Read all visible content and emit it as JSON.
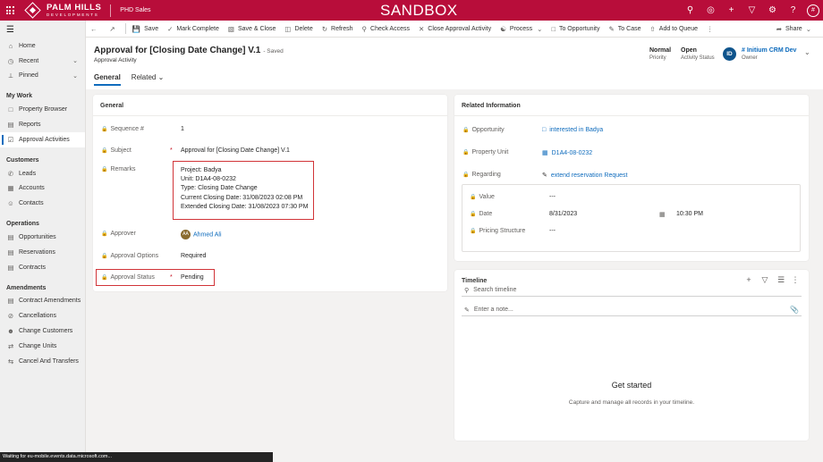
{
  "topbar": {
    "logo_main": "PALM HILLS",
    "logo_sub": "DEVELOPMENTS",
    "app_name": "PHD Sales",
    "environment": "SANDBOX",
    "user_initial": "#"
  },
  "sidebar": {
    "top_items": [
      {
        "label": "Home",
        "icon": "home-icon"
      },
      {
        "label": "Recent",
        "icon": "clock-icon"
      },
      {
        "label": "Pinned",
        "icon": "pin-icon"
      }
    ],
    "sections": [
      {
        "title": "My Work",
        "items": [
          {
            "label": "Property Browser"
          },
          {
            "label": "Reports"
          },
          {
            "label": "Approval Activities",
            "active": true
          }
        ]
      },
      {
        "title": "Customers",
        "items": [
          {
            "label": "Leads"
          },
          {
            "label": "Accounts"
          },
          {
            "label": "Contacts"
          }
        ]
      },
      {
        "title": "Operations",
        "items": [
          {
            "label": "Opportunities"
          },
          {
            "label": "Reservations"
          },
          {
            "label": "Contracts"
          }
        ]
      },
      {
        "title": "Amendments",
        "items": [
          {
            "label": "Contract Amendments"
          },
          {
            "label": "Cancellations"
          },
          {
            "label": "Change Customers"
          },
          {
            "label": "Change Units"
          },
          {
            "label": "Cancel And Transfers"
          }
        ]
      }
    ]
  },
  "commands": {
    "save": "Save",
    "mark_complete": "Mark Complete",
    "save_close": "Save & Close",
    "delete": "Delete",
    "refresh": "Refresh",
    "check_access": "Check Access",
    "close_approval": "Close Approval Activity",
    "process": "Process",
    "to_opportunity": "To Opportunity",
    "to_case": "To Case",
    "add_to_queue": "Add to Queue",
    "share": "Share"
  },
  "header": {
    "title": "Approval for [Closing Date Change] V.1",
    "saved": "- Saved",
    "record_type": "Approval Activity",
    "priority_value": "Normal",
    "priority_label": "Priority",
    "status_value": "Open",
    "status_label": "Activity Status",
    "owner_initials": "ID",
    "owner_name": "# Initium CRM Dev",
    "owner_label": "Owner",
    "tabs": [
      "General",
      "Related"
    ]
  },
  "general": {
    "title": "General",
    "sequence_label": "Sequence #",
    "sequence_value": "1",
    "subject_label": "Subject",
    "subject_value": "Approval for [Closing Date Change] V.1",
    "remarks_label": "Remarks",
    "remarks_lines": [
      "Project: Badya",
      "Unit: D1A4-08-0232",
      "Type: Closing Date Change",
      "Current Closing Date: 31/08/2023 02:08 PM",
      "Extended Closing Date: 31/08/2023 07:30 PM"
    ],
    "approver_label": "Approver",
    "approver_initials": "AA",
    "approver_value": "Ahmed Ali",
    "approval_options_label": "Approval Options",
    "approval_options_value": "Required",
    "approval_status_label": "Approval Status",
    "approval_status_value": "Pending",
    "required_mark": "*"
  },
  "related_info": {
    "title": "Related Information",
    "opportunity_label": "Opportunity",
    "opportunity_value": "interested in Badya",
    "property_unit_label": "Property Unit",
    "property_unit_value": "D1A4-08-0232",
    "regarding_label": "Regarding",
    "regarding_value": "extend reservation Request",
    "value_label": "Value",
    "value_value": "---",
    "date_label": "Date",
    "date_value": "8/31/2023",
    "time_value": "10:30 PM",
    "pricing_label": "Pricing Structure",
    "pricing_value": "---"
  },
  "timeline": {
    "title": "Timeline",
    "search_placeholder": "Search timeline",
    "note_placeholder": "Enter a note...",
    "empty_title": "Get started",
    "empty_sub": "Capture and manage all records in your timeline."
  },
  "status_bar": "Waiting for eu-mobile.events.data.microsoft.com..."
}
